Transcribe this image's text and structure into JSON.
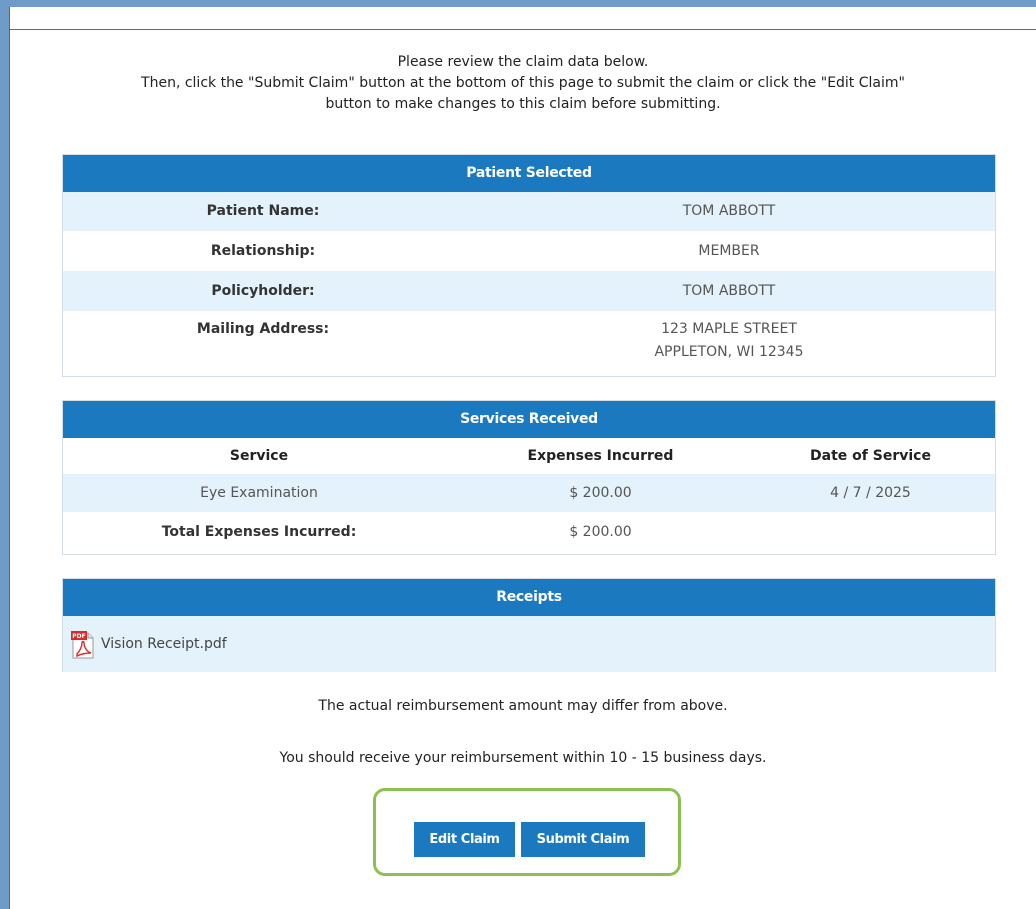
{
  "intro": {
    "line1": "Please review the claim data below.",
    "line2": "Then, click the \"Submit Claim\" button at the bottom of this page to submit the claim or click the \"Edit Claim\"",
    "line3": "button to make changes to this claim before submitting."
  },
  "patient": {
    "header": "Patient Selected",
    "rows": [
      {
        "label": "Patient Name:",
        "value": "TOM ABBOTT"
      },
      {
        "label": "Relationship:",
        "value": "MEMBER"
      },
      {
        "label": "Policyholder:",
        "value": "TOM ABBOTT"
      }
    ],
    "address_label": "Mailing Address:",
    "address_line1": "123 MAPLE STREET",
    "address_line2": "APPLETON, WI 12345"
  },
  "services": {
    "header": "Services Received",
    "columns": [
      "Service",
      "Expenses Incurred",
      "Date of Service"
    ],
    "rows": [
      {
        "service": "Eye Examination",
        "expense": "$ 200.00",
        "date": "4 / 7 / 2025"
      }
    ],
    "total_label": "Total Expenses Incurred:",
    "total_value": "$ 200.00"
  },
  "receipts": {
    "header": "Receipts",
    "files": [
      {
        "name": "Vision Receipt.pdf",
        "icon": "pdf-icon",
        "icon_badge": "PDF"
      }
    ]
  },
  "notes": {
    "reimbursement": "The actual reimbursement amount may differ from above.",
    "timing": "You should receive your reimbursement within 10 - 15 business days."
  },
  "actions": {
    "edit_label": "Edit Claim",
    "submit_label": "Submit Claim"
  },
  "colors": {
    "accent": "#1b7abf",
    "row_shade": "#e4f2fb",
    "highlight": "#8cc152"
  }
}
